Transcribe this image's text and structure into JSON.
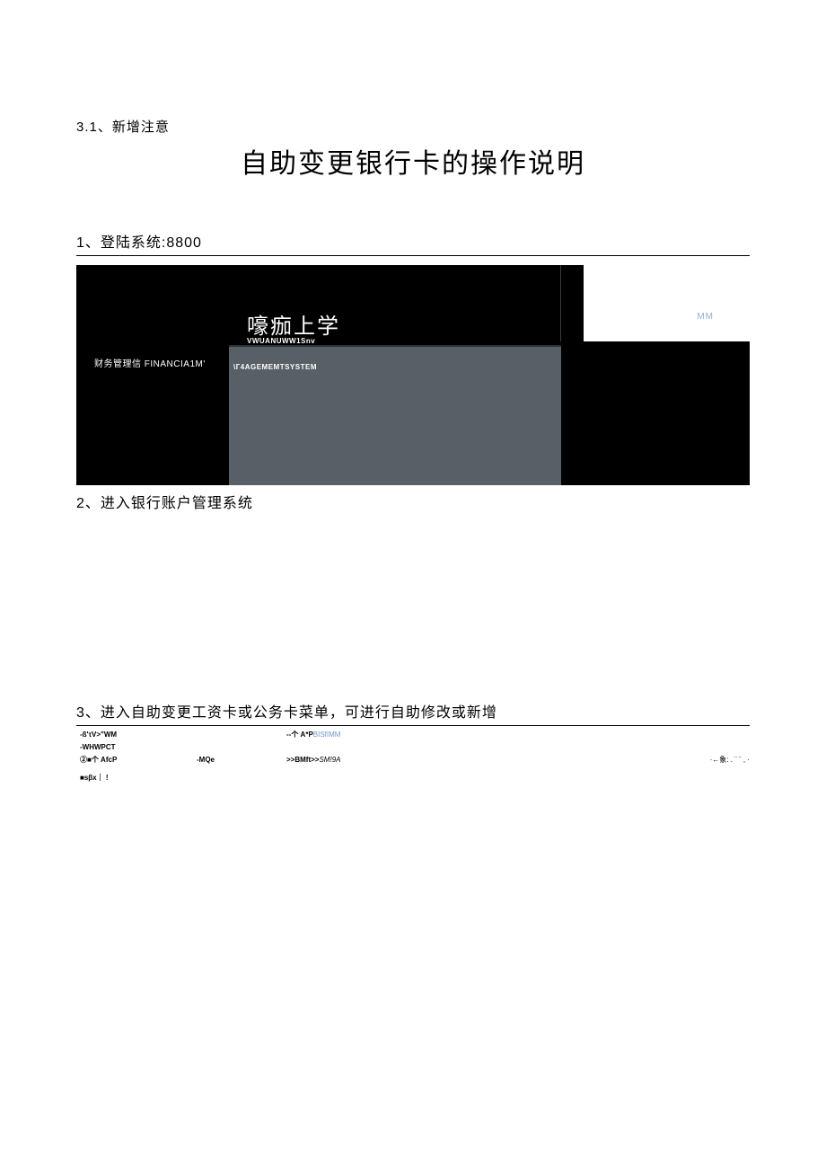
{
  "section_note": "3.1、新增注意",
  "main_title": "自助变更银行卡的操作说明",
  "step1": {
    "heading": "1、登陆系统:8800",
    "mm_label": "MM",
    "title": "嚎痂上学",
    "subtitle": "VWUANUWW1Snv",
    "left_label": "财务管理信 FINANCIA1M'",
    "gray_label": "\\Г4AGEMEMTSYSTEM"
  },
  "step2": {
    "heading": "2、进入银行账户管理系统"
  },
  "step3": {
    "heading": "3、进入自助变更工资卡或公务卡菜单，可进行自助修改或新增",
    "row1_left": "-ß'τV>\"WM",
    "row1_mid2_a": "--个 A*P",
    "row1_mid2_b": "BISfIMM",
    "row2_left": "-WHWPCT",
    "row3_left": "②■个 AfcP",
    "row3_mid": "-MQe",
    "row3_mid2_a": ">>BMft>>",
    "row3_mid2_b": "SM!9A",
    "row3_right": "·←象:  . ¨ ¨ , ·",
    "row4_left": "■sβx｜ !"
  }
}
